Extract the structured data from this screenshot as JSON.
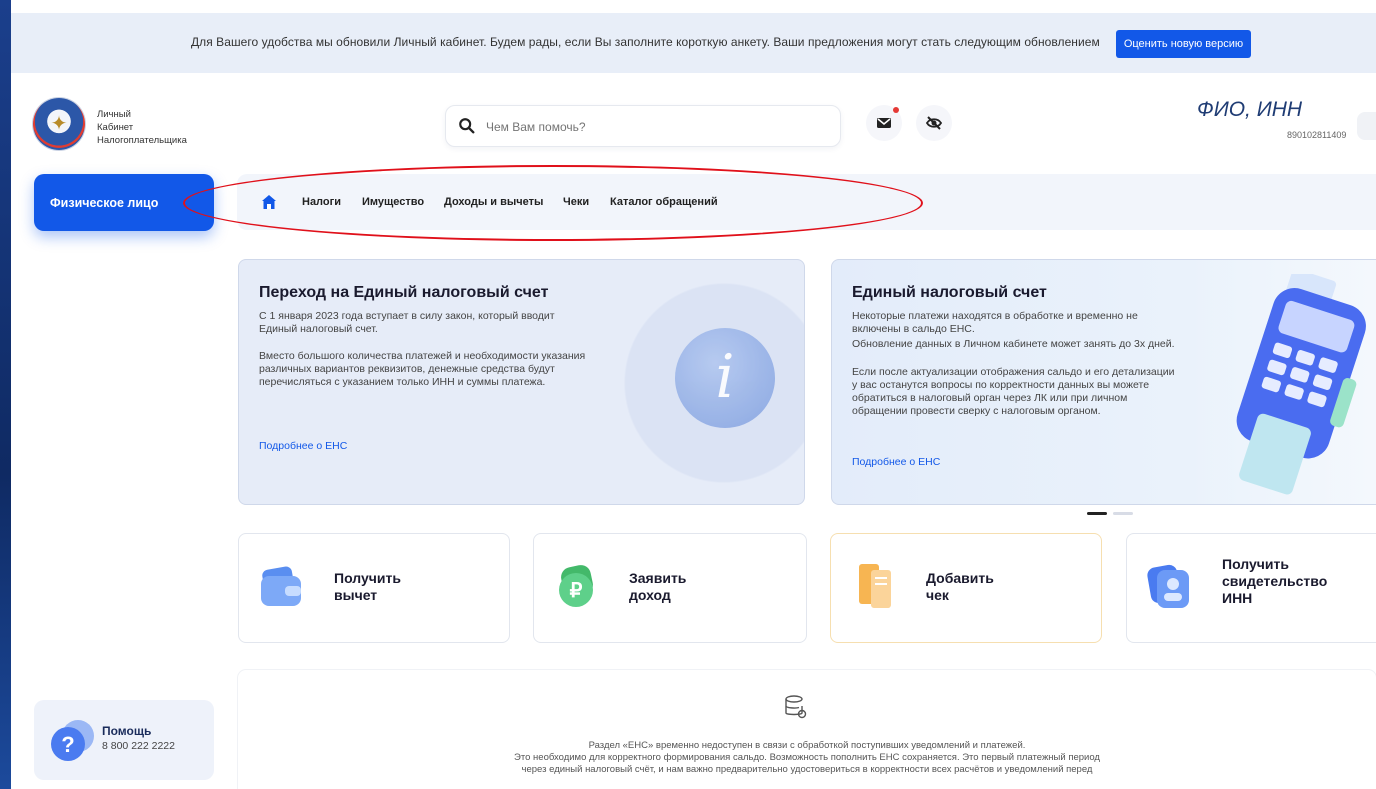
{
  "banner": {
    "text": "Для Вашего удобства мы обновили Личный кабинет. Будем рады, если Вы заполните короткую анкету. Ваши предложения могут стать следующим обновлением",
    "button_label": "Оценить новую версию"
  },
  "brand": {
    "line1": "Личный",
    "line2": "Кабинет",
    "line3": "Налогоплательщика"
  },
  "search": {
    "placeholder": "Чем Вам помочь?"
  },
  "user": {
    "fio_label": "ФИО, ИНН",
    "inn": "890102811409"
  },
  "sidebar": {
    "active_label": "Физическое лицо"
  },
  "nav": {
    "items": [
      "Налоги",
      "Имущество",
      "Доходы и вычеты",
      "Чеки",
      "Каталог обращений"
    ]
  },
  "card_ens_transition": {
    "title": "Переход на Единый налоговый счет",
    "p1": "С 1 января 2023 года вступает в силу закон, который вводит Единый налоговый счет.",
    "p2": "Вместо большого количества платежей и необходимости указания различных вариантов реквизитов, денежные средства будут перечисляться с указанием только ИНН и суммы платежа.",
    "link": "Подробнее о ЕНС"
  },
  "card_ens": {
    "title": "Единый налоговый счет",
    "p1": "Некоторые платежи находятся в обработке и временно не включены в сальдо ЕНС.",
    "p2": "Обновление данных в Личном кабинете может занять до 3х дней.",
    "p3": "Если после актуализации отображения сальдо и его детализации у вас останутся вопросы по корректности данных вы можете обратиться в налоговый орган через ЛК или при личном обращении провести сверку с налоговым органом.",
    "link": "Подробнее о ЕНС"
  },
  "tiles": [
    {
      "line1": "Получить",
      "line2": "вычет"
    },
    {
      "line1": "Заявить",
      "line2": "доход"
    },
    {
      "line1": "Добавить",
      "line2": "чек"
    },
    {
      "line1": "Получить",
      "line2": "свидетельство",
      "line3": "ИНН"
    }
  ],
  "notice": {
    "line1": "Раздел «ЕНС» временно недоступен в связи с обработкой поступивших уведомлений и платежей.",
    "line2": "Это необходимо для корректного формирования сальдо. Возможность пополнить ЕНС сохраняется. Это первый платежный период",
    "line3": "через единый налоговый счёт, и нам важно предварительно удостовериться в корректности всех расчётов и уведомлений перед"
  },
  "help": {
    "title": "Помощь",
    "phone": "8 800 222 2222"
  },
  "colors": {
    "accent": "#1258e8",
    "highlight_ring": "#e0101a",
    "notification_dot": "#e53935"
  }
}
